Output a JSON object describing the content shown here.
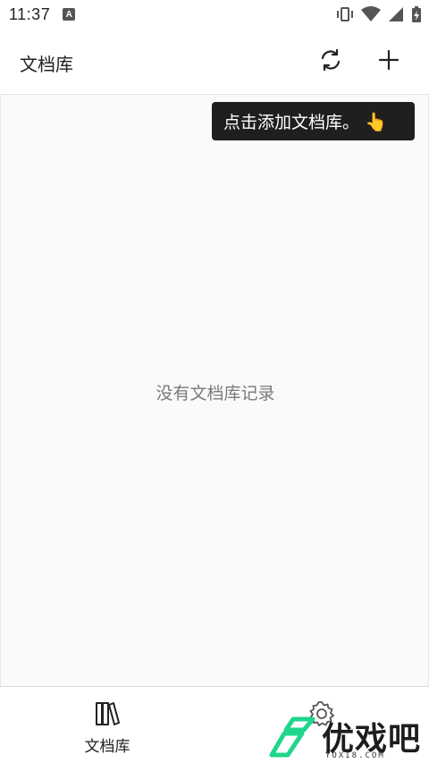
{
  "status_bar": {
    "time": "11:37",
    "notification_letter": "A",
    "icons": [
      "vibrate-icon",
      "wifi-icon",
      "cell-signal-icon",
      "battery-charging-icon"
    ]
  },
  "app_bar": {
    "title": "文档库",
    "actions": [
      "refresh-icon",
      "add-icon"
    ]
  },
  "tooltip": {
    "text": "点击添加文档库。",
    "emoji": "👆"
  },
  "content": {
    "empty_message": "没有文档库记录"
  },
  "bottom_nav": {
    "items": [
      {
        "label": "文档库",
        "icon": "books-icon"
      },
      {
        "label": "",
        "icon": "gear-icon"
      }
    ]
  },
  "watermark": {
    "text": "优戏吧",
    "sub": "YOXI8.COM",
    "color": "#1fd68a"
  }
}
